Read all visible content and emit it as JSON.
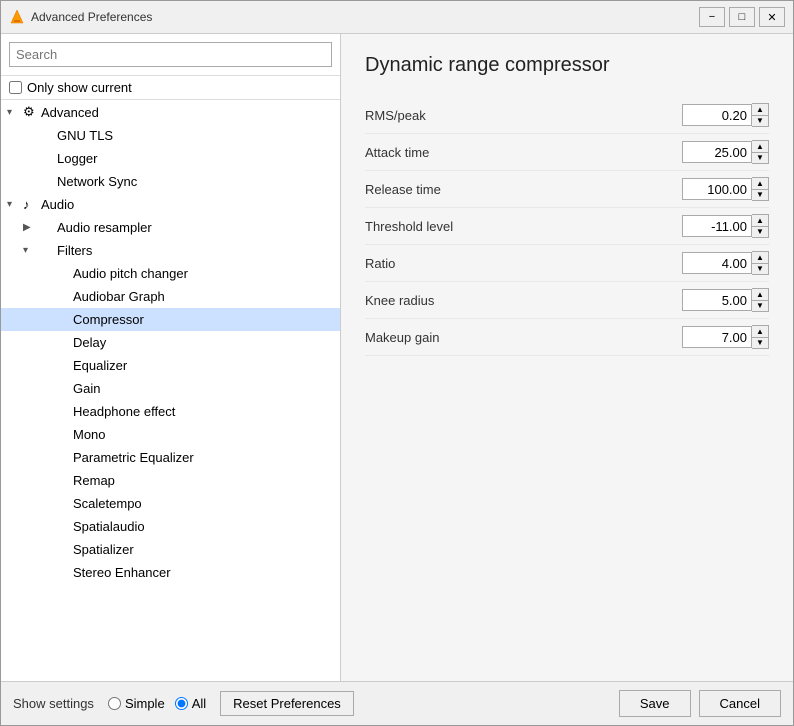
{
  "window": {
    "title": "Advanced Preferences",
    "minimize_label": "−",
    "maximize_label": "□",
    "close_label": "✕"
  },
  "search": {
    "placeholder": "Search",
    "value": ""
  },
  "only_show_current": {
    "label": "Only show current",
    "checked": false
  },
  "tree": {
    "items": [
      {
        "id": "advanced",
        "label": "Advanced",
        "indent": 1,
        "expanded": true,
        "has_arrow": true,
        "arrow": "▾",
        "has_icon": true,
        "icon": "⚙",
        "selected": false
      },
      {
        "id": "gnu-tls",
        "label": "GNU TLS",
        "indent": 2,
        "expanded": false,
        "has_arrow": false,
        "has_icon": false,
        "selected": false
      },
      {
        "id": "logger",
        "label": "Logger",
        "indent": 2,
        "expanded": false,
        "has_arrow": false,
        "has_icon": false,
        "selected": false
      },
      {
        "id": "network-sync",
        "label": "Network Sync",
        "indent": 2,
        "expanded": false,
        "has_arrow": false,
        "has_icon": false,
        "selected": false
      },
      {
        "id": "audio",
        "label": "Audio",
        "indent": 1,
        "expanded": true,
        "has_arrow": true,
        "arrow": "▾",
        "has_icon": true,
        "icon": "♪",
        "selected": false
      },
      {
        "id": "audio-resampler",
        "label": "Audio resampler",
        "indent": 2,
        "expanded": false,
        "has_arrow": true,
        "arrow": "▶",
        "has_icon": false,
        "selected": false
      },
      {
        "id": "filters",
        "label": "Filters",
        "indent": 2,
        "expanded": true,
        "has_arrow": true,
        "arrow": "▾",
        "has_icon": false,
        "selected": false
      },
      {
        "id": "audio-pitch-changer",
        "label": "Audio pitch changer",
        "indent": 3,
        "expanded": false,
        "has_arrow": false,
        "has_icon": false,
        "selected": false
      },
      {
        "id": "audiobar-graph",
        "label": "Audiobar Graph",
        "indent": 3,
        "expanded": false,
        "has_arrow": false,
        "has_icon": false,
        "selected": false
      },
      {
        "id": "compressor",
        "label": "Compressor",
        "indent": 3,
        "expanded": false,
        "has_arrow": false,
        "has_icon": false,
        "selected": true
      },
      {
        "id": "delay",
        "label": "Delay",
        "indent": 3,
        "expanded": false,
        "has_arrow": false,
        "has_icon": false,
        "selected": false
      },
      {
        "id": "equalizer",
        "label": "Equalizer",
        "indent": 3,
        "expanded": false,
        "has_arrow": false,
        "has_icon": false,
        "selected": false
      },
      {
        "id": "gain",
        "label": "Gain",
        "indent": 3,
        "expanded": false,
        "has_arrow": false,
        "has_icon": false,
        "selected": false
      },
      {
        "id": "headphone-effect",
        "label": "Headphone effect",
        "indent": 3,
        "expanded": false,
        "has_arrow": false,
        "has_icon": false,
        "selected": false
      },
      {
        "id": "mono",
        "label": "Mono",
        "indent": 3,
        "expanded": false,
        "has_arrow": false,
        "has_icon": false,
        "selected": false
      },
      {
        "id": "parametric-equalizer",
        "label": "Parametric Equalizer",
        "indent": 3,
        "expanded": false,
        "has_arrow": false,
        "has_icon": false,
        "selected": false
      },
      {
        "id": "remap",
        "label": "Remap",
        "indent": 3,
        "expanded": false,
        "has_arrow": false,
        "has_icon": false,
        "selected": false
      },
      {
        "id": "scaletempo",
        "label": "Scaletempo",
        "indent": 3,
        "expanded": false,
        "has_arrow": false,
        "has_icon": false,
        "selected": false
      },
      {
        "id": "spatialaudio",
        "label": "Spatialaudio",
        "indent": 3,
        "expanded": false,
        "has_arrow": false,
        "has_icon": false,
        "selected": false
      },
      {
        "id": "spatializer",
        "label": "Spatializer",
        "indent": 3,
        "expanded": false,
        "has_arrow": false,
        "has_icon": false,
        "selected": false
      },
      {
        "id": "stereo-enhancer",
        "label": "Stereo Enhancer",
        "indent": 3,
        "expanded": false,
        "has_arrow": false,
        "has_icon": false,
        "selected": false
      }
    ]
  },
  "panel": {
    "title": "Dynamic range compressor",
    "settings": [
      {
        "id": "rms-peak",
        "label": "RMS/peak",
        "value": "0.20"
      },
      {
        "id": "attack-time",
        "label": "Attack time",
        "value": "25.00"
      },
      {
        "id": "release-time",
        "label": "Release time",
        "value": "100.00"
      },
      {
        "id": "threshold-level",
        "label": "Threshold level",
        "value": "-11.00"
      },
      {
        "id": "ratio",
        "label": "Ratio",
        "value": "4.00"
      },
      {
        "id": "knee-radius",
        "label": "Knee radius",
        "value": "5.00"
      },
      {
        "id": "makeup-gain",
        "label": "Makeup gain",
        "value": "7.00"
      }
    ]
  },
  "bottom": {
    "show_settings_label": "Show settings",
    "simple_label": "Simple",
    "all_label": "All",
    "reset_label": "Reset Preferences",
    "save_label": "Save",
    "cancel_label": "Cancel"
  }
}
